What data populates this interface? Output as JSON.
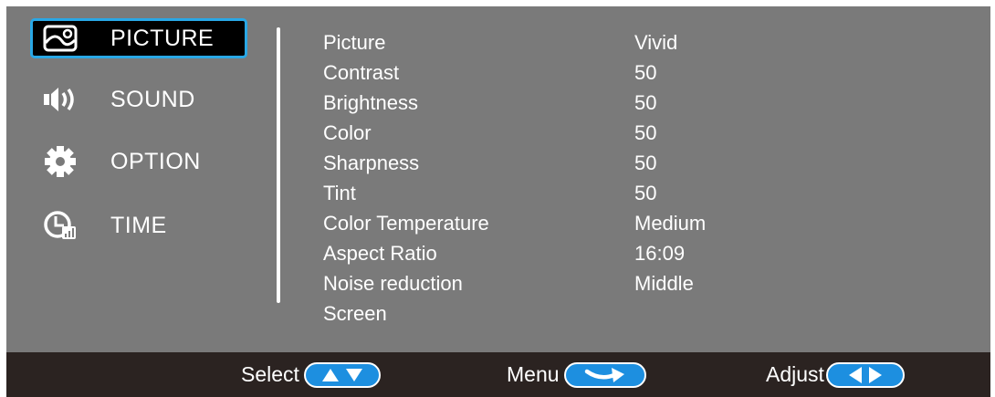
{
  "sidebar": {
    "items": [
      {
        "label": "PICTURE",
        "icon": "picture-icon",
        "selected": true
      },
      {
        "label": "SOUND",
        "icon": "speaker-icon",
        "selected": false
      },
      {
        "label": "OPTION",
        "icon": "gear-icon",
        "selected": false
      },
      {
        "label": "TIME",
        "icon": "clock-icon",
        "selected": false
      }
    ]
  },
  "settings": [
    {
      "label": "Picture",
      "value": "Vivid"
    },
    {
      "label": "Contrast",
      "value": "50"
    },
    {
      "label": "Brightness",
      "value": "50"
    },
    {
      "label": "Color",
      "value": "50"
    },
    {
      "label": "Sharpness",
      "value": "50"
    },
    {
      "label": "Tint",
      "value": "50"
    },
    {
      "label": "Color Temperature",
      "value": "Medium"
    },
    {
      "label": "Aspect Ratio",
      "value": "16:09"
    },
    {
      "label": "Noise reduction",
      "value": "Middle"
    },
    {
      "label": "Screen",
      "value": ""
    }
  ],
  "bottom_bar": {
    "select_label": "Select",
    "menu_label": "Menu",
    "adjust_label": "Adjust"
  },
  "colors": {
    "panel_bg": "#7a7a7a",
    "bottom_bar_bg": "#2b2321",
    "highlight_border": "#29a8e6",
    "pill_blue": "#1d8fe0",
    "text": "#ffffff"
  }
}
